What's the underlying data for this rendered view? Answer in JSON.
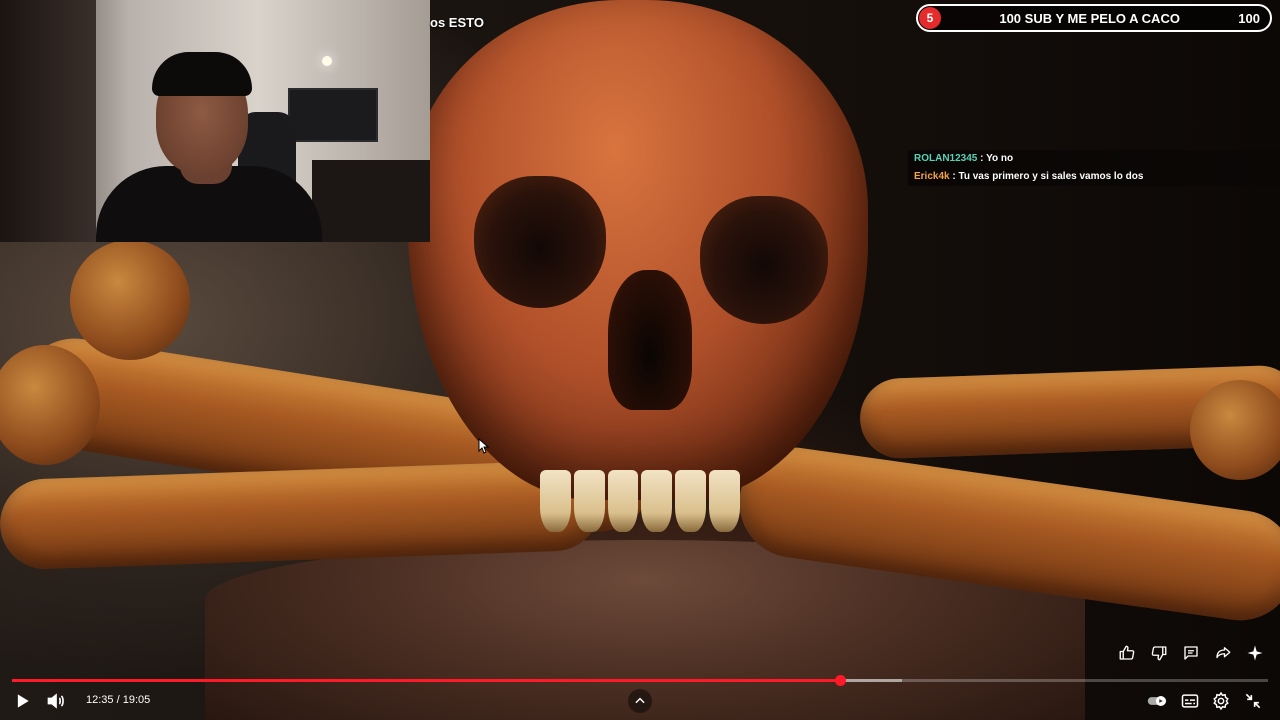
{
  "stream": {
    "title_fragment": "os ESTO"
  },
  "sub_goal": {
    "current": "5",
    "label": "100 SUB Y ME PELO A CACO",
    "target": "100"
  },
  "chat": {
    "messages": [
      {
        "user": "ROLAN12345",
        "text": ": Yo no",
        "user_color": "#5ad1b5"
      },
      {
        "user": "Erick4k",
        "text": ": Tu vas primero y si sales vamos lo dos",
        "user_color": "#f2a34a"
      }
    ]
  },
  "player": {
    "time_current": "12:35",
    "time_separator": " / ",
    "time_total": "19:05",
    "progress_fraction": 0.659,
    "accent_color": "#ff1a2a"
  },
  "icons": {
    "side_actions": [
      "like-icon",
      "dislike-icon",
      "comment-icon",
      "share-icon",
      "sparkle-icon"
    ],
    "controls_left": [
      "play-icon",
      "volume-icon"
    ],
    "controls_right": [
      "autoplay-toggle-icon",
      "subtitles-icon",
      "settings-icon",
      "exit-fullscreen-icon"
    ],
    "center": "chevron-up-icon"
  }
}
